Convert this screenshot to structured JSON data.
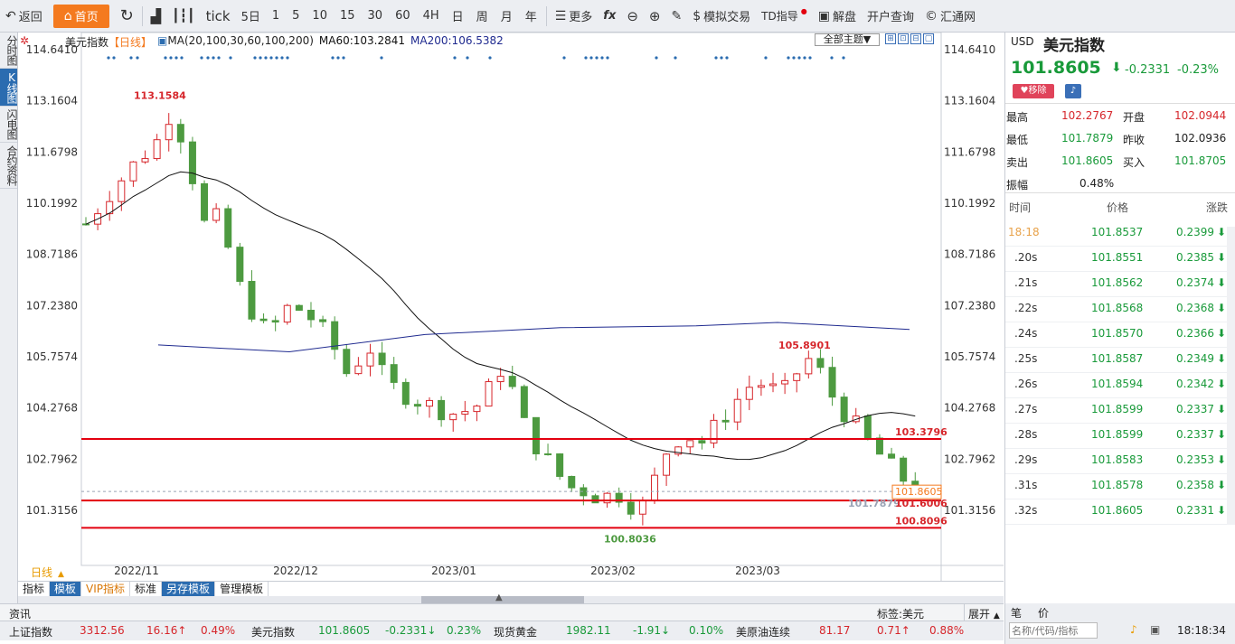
{
  "toolbar": {
    "back": "返回",
    "home": "首页",
    "tick": "tick",
    "five_day": "5日",
    "periods": [
      "1",
      "5",
      "10",
      "15",
      "30",
      "60",
      "4H",
      "日",
      "周",
      "月",
      "年"
    ],
    "more": "更多",
    "fx": "fx",
    "sim_trade": "模拟交易",
    "td": "TD指导",
    "unlock": "解盘",
    "open_query": "开户查询",
    "brand": "汇通网"
  },
  "left_tabs": [
    "分时图",
    "K线图",
    "闪电图",
    "合约资料"
  ],
  "legend": {
    "name": "美元指数",
    "period": "【日线】",
    "ma": "MA(20,100,30,60,100,200)",
    "ma60": "MA60:103.2841",
    "ma200": "MA200:106.5382",
    "theme": "全部主题▼"
  },
  "y_axis": [
    "114.6410",
    "113.1604",
    "111.6798",
    "110.1992",
    "108.7186",
    "107.2380",
    "105.7574",
    "104.2768",
    "102.7962",
    "101.3156"
  ],
  "x_axis": [
    "2022/11",
    "2022/12",
    "2023/01",
    "2023/02",
    "2023/03"
  ],
  "period_label": "日线",
  "annotations": {
    "high": "113.1584",
    "high2": "105.8901",
    "low": "100.8036",
    "low2": "101.7879",
    "line1": "103.3796",
    "line2": "101.6006",
    "line3": "100.8096",
    "current": "101.8605"
  },
  "colors": {
    "up": "#d6262b",
    "down": "#4d9a40",
    "ma60": "#111111",
    "ma200": "#1f2a8f",
    "hline": "#e3000f",
    "accent": "#f47a1f"
  },
  "chart_data": {
    "type": "candlestick",
    "x": [
      "2022/11",
      "2022/12",
      "2023/01",
      "2023/02",
      "2023/03"
    ],
    "ylim": [
      100.6,
      114.9
    ],
    "y_ticks": [
      114.641,
      113.1604,
      111.6798,
      110.1992,
      108.7186,
      107.238,
      105.7574,
      104.2768,
      102.7962,
      101.3156
    ],
    "horizontal_lines": [
      103.3796,
      101.6006,
      100.8096
    ],
    "high": 113.1584,
    "low": 100.8036,
    "last": 101.8605
  },
  "subtabs": [
    "指标",
    "模板",
    "VIP指标",
    "标准",
    "另存模板",
    "管理模板"
  ],
  "infobar": {
    "left": "资讯",
    "tag": "标签:美元",
    "expand": "展开",
    "sym": "▲"
  },
  "ticker": [
    {
      "name": "上证指数",
      "price": "3312.56",
      "chg": "16.16↑",
      "pct": "0.49%"
    },
    {
      "name": "美元指数",
      "price": "101.8605",
      "chg": "-0.2331↓",
      "pct": "0.23%"
    },
    {
      "name": "现货黄金",
      "price": "1982.11",
      "chg": "-1.91↓",
      "pct": "0.10%"
    },
    {
      "name": "美原油连续",
      "price": "81.17",
      "chg": "0.71↑",
      "pct": "0.88%"
    }
  ],
  "quote": {
    "cur": "USD",
    "name": "美元指数",
    "price": "101.8605",
    "chg": "-0.2331",
    "pct": "-0.23%",
    "remove": "移除",
    "high_l": "最高",
    "high": "102.2767",
    "open_l": "开盘",
    "open": "102.0944",
    "low_l": "最低",
    "low": "101.7879",
    "prev_l": "昨收",
    "prev": "102.0936",
    "sell_l": "卖出",
    "sell": "101.8605",
    "buy_l": "买入",
    "buy": "101.8705",
    "amp_l": "振幅",
    "amp": "0.48%"
  },
  "trades_header": [
    "时间",
    "价格",
    "涨跌"
  ],
  "trades": [
    {
      "t": "18:18",
      "p": "101.8537",
      "c": "0.2399"
    },
    {
      "t": ".20s",
      "p": "101.8551",
      "c": "0.2385"
    },
    {
      "t": ".21s",
      "p": "101.8562",
      "c": "0.2374"
    },
    {
      "t": ".22s",
      "p": "101.8568",
      "c": "0.2368"
    },
    {
      "t": ".24s",
      "p": "101.8570",
      "c": "0.2366"
    },
    {
      "t": ".25s",
      "p": "101.8587",
      "c": "0.2349"
    },
    {
      "t": ".26s",
      "p": "101.8594",
      "c": "0.2342"
    },
    {
      "t": ".27s",
      "p": "101.8599",
      "c": "0.2337"
    },
    {
      "t": ".28s",
      "p": "101.8599",
      "c": "0.2337"
    },
    {
      "t": ".29s",
      "p": "101.8583",
      "c": "0.2353"
    },
    {
      "t": ".31s",
      "p": "101.8578",
      "c": "0.2358"
    },
    {
      "t": ".32s",
      "p": "101.8605",
      "c": "0.2331"
    }
  ],
  "bottom_right": {
    "pen": "笔",
    "price": "价",
    "search_placeholder": "名称/代码/指标",
    "time": "18:18:34"
  }
}
